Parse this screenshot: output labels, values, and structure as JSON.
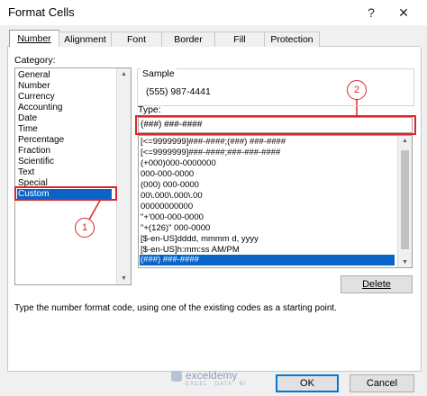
{
  "window": {
    "title": "Format Cells",
    "help": "?",
    "close": "✕"
  },
  "tabs": [
    {
      "label": "Number"
    },
    {
      "label": "Alignment"
    },
    {
      "label": "Font"
    },
    {
      "label": "Border"
    },
    {
      "label": "Fill"
    },
    {
      "label": "Protection"
    }
  ],
  "category": {
    "label": "Category:",
    "items": [
      "General",
      "Number",
      "Currency",
      "Accounting",
      "Date",
      "Time",
      "Percentage",
      "Fraction",
      "Scientific",
      "Text",
      "Special",
      "Custom"
    ],
    "selected": "Custom"
  },
  "sample": {
    "label": "Sample",
    "value": "(555) 987-4441"
  },
  "type": {
    "label": "Type:",
    "value": "(###) ###-####"
  },
  "formats": {
    "items": [
      "[<=9999999]###-####;(###) ###-####",
      "[<=9999999]###-####;###-###-####",
      "(+000)000-0000000",
      "000-000-0000",
      "(000) 000-0000",
      "00\\.000\\.000\\.00",
      "00000000000",
      "\"+'000-000-0000",
      "\"+(126)\" 000-0000",
      "[$-en-US]dddd, mmmm d, yyyy",
      "[$-en-US]h:mm:ss AM/PM",
      "(###) ###-####"
    ],
    "selected": "(###) ###-####"
  },
  "buttons": {
    "delete": "Delete",
    "ok": "OK",
    "cancel": "Cancel"
  },
  "hint": "Type the number format code, using one of the existing codes as a starting point.",
  "annotations": {
    "marker1": "1",
    "marker2": "2",
    "color": "#d9262b"
  },
  "watermark": {
    "name": "exceldemy",
    "sub": "EXCEL · DATA · BI"
  },
  "colors": {
    "selection": "#0a64c8",
    "annotation": "#d9262b"
  }
}
